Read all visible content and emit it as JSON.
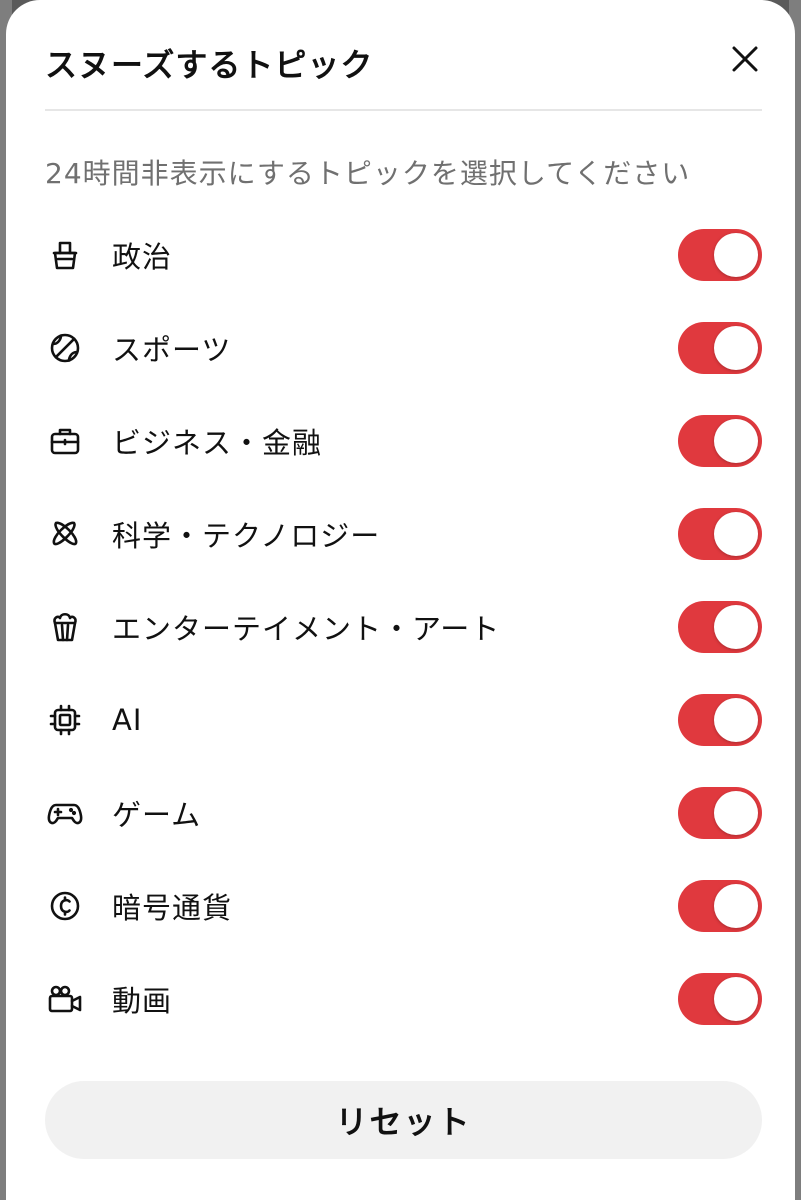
{
  "dialog": {
    "title": "スヌーズするトピック",
    "subtitle": "24時間非表示にするトピックを選択してください",
    "reset_label": "リセット"
  },
  "topics": [
    {
      "label": "政治",
      "icon": "ballot-box-icon",
      "enabled": true
    },
    {
      "label": "スポーツ",
      "icon": "ball-icon",
      "enabled": true
    },
    {
      "label": "ビジネス・金融",
      "icon": "briefcase-icon",
      "enabled": true
    },
    {
      "label": "科学・テクノロジー",
      "icon": "atom-icon",
      "enabled": true
    },
    {
      "label": "エンターテイメント・アート",
      "icon": "popcorn-icon",
      "enabled": true
    },
    {
      "label": "AI",
      "icon": "chip-icon",
      "enabled": true
    },
    {
      "label": "ゲーム",
      "icon": "gamepad-icon",
      "enabled": true
    },
    {
      "label": "暗号通貨",
      "icon": "coin-icon",
      "enabled": true
    },
    {
      "label": "動画",
      "icon": "video-camera-icon",
      "enabled": true
    }
  ],
  "colors": {
    "toggle_on": "#e0393e",
    "subtitle_text": "#707070",
    "reset_background": "#f1f1f1"
  }
}
